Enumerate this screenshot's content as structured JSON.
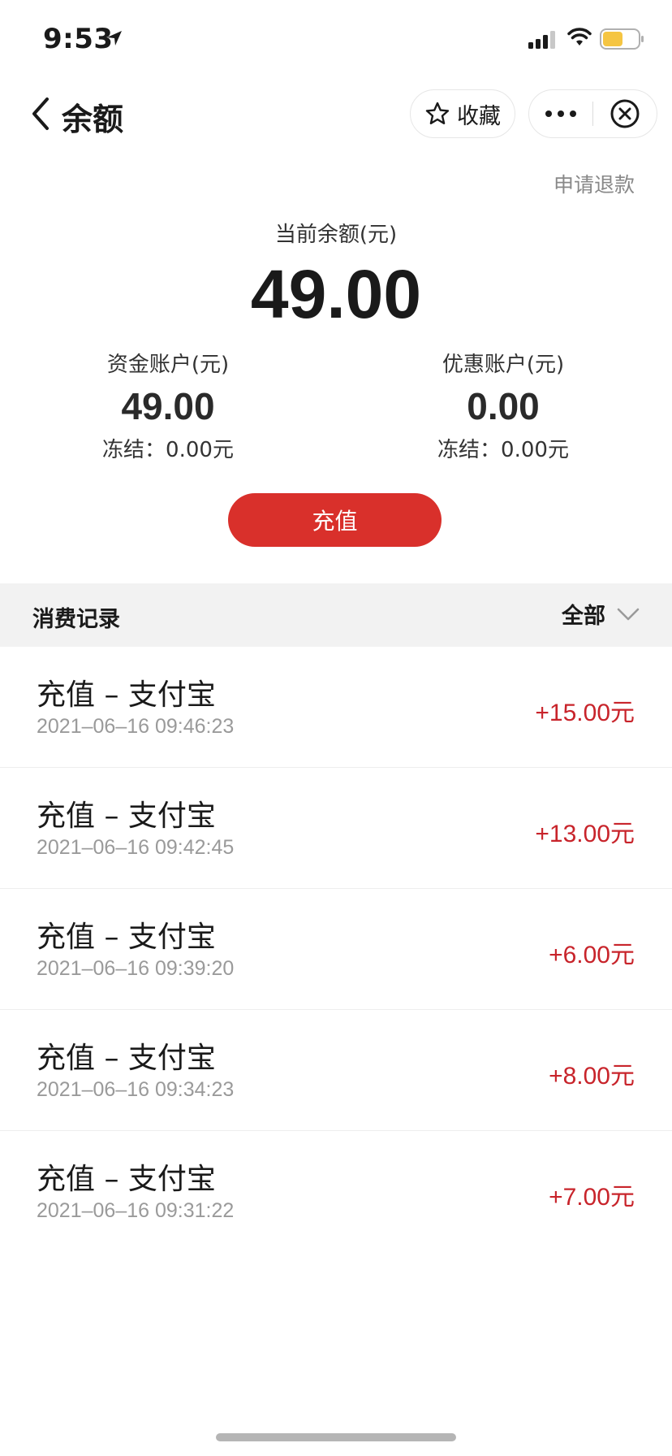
{
  "status_bar": {
    "time": "9:53"
  },
  "nav": {
    "title": "余额",
    "favorite_label": "收藏"
  },
  "refund_link": "申请退款",
  "balance": {
    "label": "当前余额(元)",
    "value": "49.00"
  },
  "accounts": [
    {
      "label": "资金账户(元)",
      "value": "49.00",
      "frozen": "冻结：0.00元"
    },
    {
      "label": "优惠账户(元)",
      "value": "0.00",
      "frozen": "冻结：0.00元"
    }
  ],
  "recharge_button": "充值",
  "records": {
    "title": "消费记录",
    "filter": "全部",
    "items": [
      {
        "title": "充值 – 支付宝",
        "time": "2021–06–16 09:46:23",
        "amount": "+15.00元"
      },
      {
        "title": "充值 – 支付宝",
        "time": "2021–06–16 09:42:45",
        "amount": "+13.00元"
      },
      {
        "title": "充值 – 支付宝",
        "time": "2021–06–16 09:39:20",
        "amount": "+6.00元"
      },
      {
        "title": "充值 – 支付宝",
        "time": "2021–06–16 09:34:23",
        "amount": "+8.00元"
      },
      {
        "title": "充值 – 支付宝",
        "time": "2021–06–16 09:31:22",
        "amount": "+7.00元"
      }
    ]
  },
  "colors": {
    "accent": "#d9302b",
    "amount": "#c8242b",
    "battery": "#f5c542"
  },
  "icons": [
    "location-arrow-icon",
    "signal-icon",
    "wifi-icon",
    "battery-icon",
    "back-chevron-icon",
    "star-icon",
    "more-dots-icon",
    "close-circle-icon",
    "chevron-down-icon"
  ]
}
